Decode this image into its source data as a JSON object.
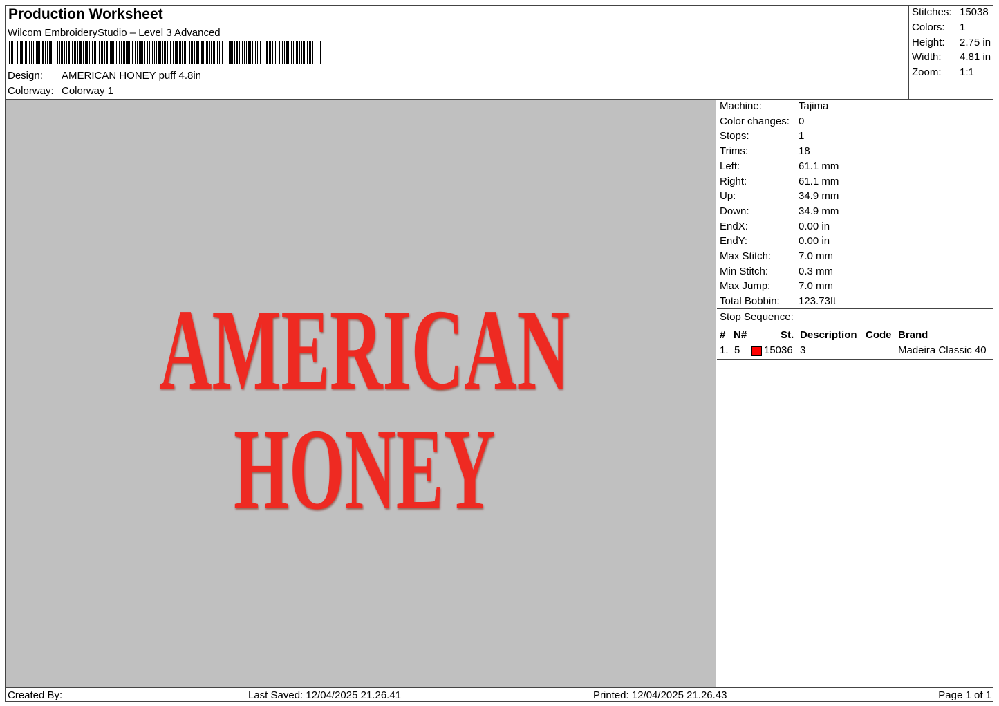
{
  "header": {
    "title": "Production Worksheet",
    "software": "Wilcom EmbroideryStudio – Level 3 Advanced",
    "design_label": "Design:",
    "design_value": "AMERICAN HONEY puff 4.8in",
    "colorway_label": "Colorway:",
    "colorway_value": "Colorway 1"
  },
  "stats": [
    {
      "label": "Stitches:",
      "value": "15038"
    },
    {
      "label": "Colors:",
      "value": "1"
    },
    {
      "label": "Height:",
      "value": "2.75 in"
    },
    {
      "label": "Width:",
      "value": "4.81 in"
    },
    {
      "label": "Zoom:",
      "value": "1:1"
    }
  ],
  "design_preview": {
    "line1": "AMERICAN",
    "line2": "HONEY",
    "thread_color": "#ee2a22",
    "background_color": "#c0c0c0"
  },
  "machine_info": [
    {
      "label": "Machine:",
      "value": "Tajima"
    },
    {
      "label": "Color changes:",
      "value": "0"
    },
    {
      "label": "Stops:",
      "value": "1"
    },
    {
      "label": "Trims:",
      "value": "18"
    },
    {
      "label": "Left:",
      "value": "61.1 mm"
    },
    {
      "label": "Right:",
      "value": "61.1 mm"
    },
    {
      "label": "Up:",
      "value": "34.9 mm"
    },
    {
      "label": "Down:",
      "value": "34.9 mm"
    },
    {
      "label": "EndX:",
      "value": "0.00 in"
    },
    {
      "label": "EndY:",
      "value": "0.00 in"
    },
    {
      "label": "Max Stitch:",
      "value": "7.0 mm"
    },
    {
      "label": "Min Stitch:",
      "value": "0.3 mm"
    },
    {
      "label": "Max Jump:",
      "value": "7.0 mm"
    },
    {
      "label": "Total Bobbin:",
      "value": "123.73ft"
    }
  ],
  "stop_sequence": {
    "title": "Stop Sequence:",
    "columns": [
      "#",
      "N#",
      "St.",
      "Description",
      "Code",
      "Brand"
    ],
    "rows": [
      {
        "num": "1.",
        "needle": "5",
        "swatch_color": "#ff0000",
        "stitches": "15036",
        "code": "3",
        "brand": "Madeira Classic 40"
      }
    ]
  },
  "footer": {
    "created_by": "Created By:",
    "last_saved": "Last Saved: 12/04/2025 21.26.41",
    "printed": "Printed: 12/04/2025 21.26.43",
    "page": "Page 1 of 1"
  }
}
